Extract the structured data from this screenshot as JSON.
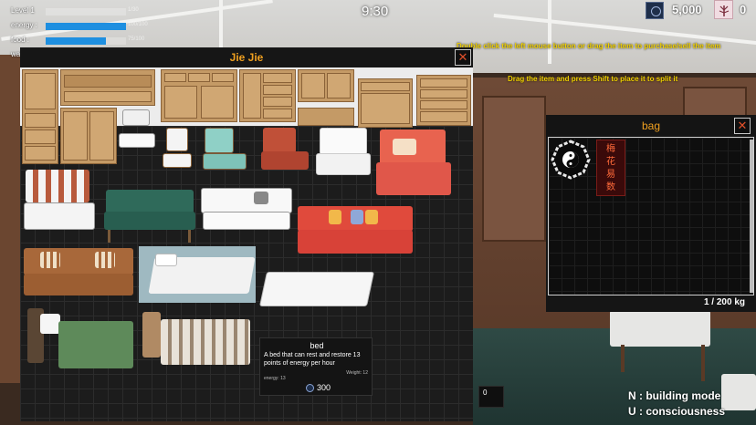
{
  "hud": {
    "stats": [
      {
        "label": "Level 1",
        "value": "1/30",
        "fill": 0.0,
        "color": "#d8d8d8"
      },
      {
        "label": "energy :",
        "value": "100/100",
        "fill": 1.0,
        "color": "#1e8fe0"
      },
      {
        "label": "food :",
        "value": "75/100",
        "fill": 0.75,
        "color": "#1e8fe0"
      },
      {
        "label": "water :",
        "value": "",
        "fill": 0.9,
        "color": "#1e8fe0"
      }
    ],
    "clock": "9:30",
    "money": "5,000",
    "tree_points": "0"
  },
  "hints": {
    "purchase": "Double click the left mouse button or drag the item to purchase/sell the item",
    "split": "Drag the item and press Shift to place it to split it"
  },
  "shop": {
    "title": "Jie Jie",
    "close": "✕"
  },
  "tooltip": {
    "name": "bed",
    "description": "A bed that can rest and restore 13 points of energy per hour",
    "weight": "Weight: 12",
    "energy": "energy: 13",
    "price": "300"
  },
  "bag": {
    "title": "bag",
    "close": "✕",
    "book_text": "梅\n花\n易\n数",
    "weight": "1 / 200 kg"
  },
  "counter": "0",
  "keys": {
    "building": "N : building mode",
    "consciousness": "U : consciousness"
  }
}
